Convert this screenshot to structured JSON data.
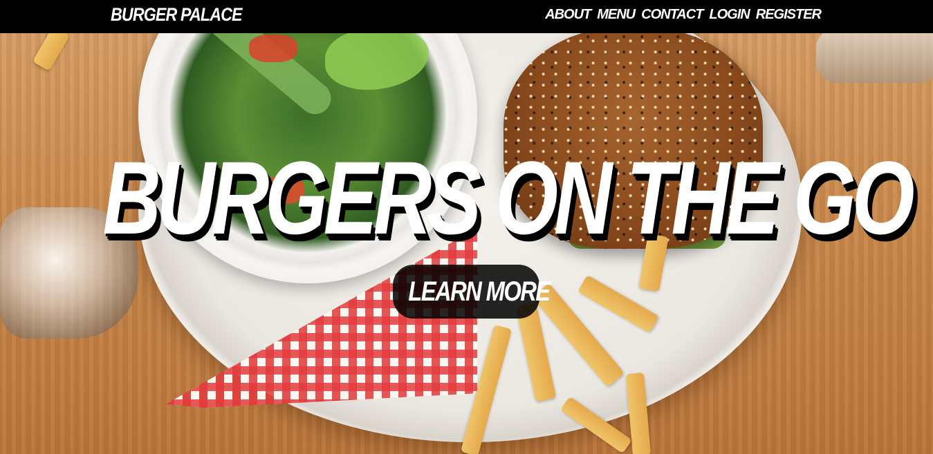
{
  "header": {
    "brand": "BURGER PALACE",
    "nav": [
      {
        "label": "ABOUT"
      },
      {
        "label": "MENU"
      },
      {
        "label": "CONTACT"
      },
      {
        "label": "LOGIN"
      },
      {
        "label": "REGISTER"
      }
    ]
  },
  "hero": {
    "title": "BURGERS ON THE GO",
    "cta_label": "LEARN MORE"
  },
  "colors": {
    "navbar": "#000000",
    "text": "#ffffff",
    "cta_background": "#000000"
  }
}
